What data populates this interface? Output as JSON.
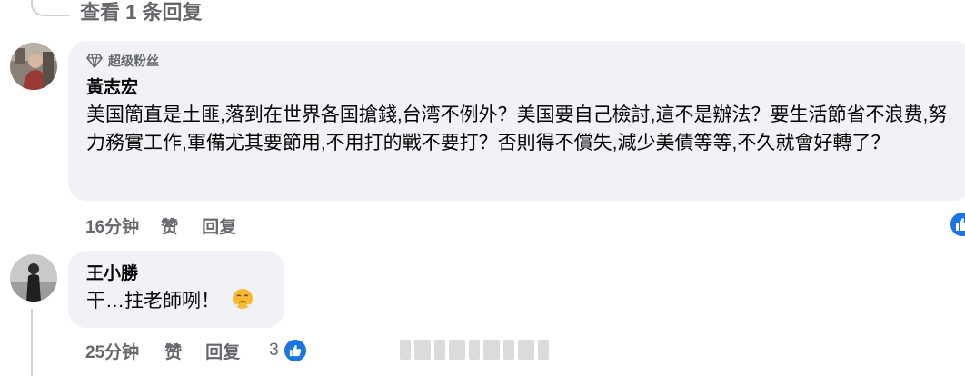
{
  "thread": {
    "view_replies": "查看 1 条回复"
  },
  "comments": [
    {
      "badge": "超级粉丝",
      "author": "黃志宏",
      "text": "美国簡直是土匪,落到在世界各国搶錢,台湾不例外？美国要自己檢討,這不是辦法？要生活節省不浪费,努力務實工作,軍備尤其要節用,不用打的戰不要打？否則得不償失,減少美債等等,不久就會好轉了？",
      "time": "16分钟",
      "like_label": "赞",
      "reply_label": "回复"
    },
    {
      "author": "王小勝",
      "text": "干…拄老師咧！",
      "time": "25分钟",
      "like_label": "赞",
      "reply_label": "回复",
      "reaction_count": "3"
    }
  ],
  "colors": {
    "bubble": "#f0f2f5",
    "meta_text": "#65676b",
    "like_blue": "#1b74e4"
  }
}
